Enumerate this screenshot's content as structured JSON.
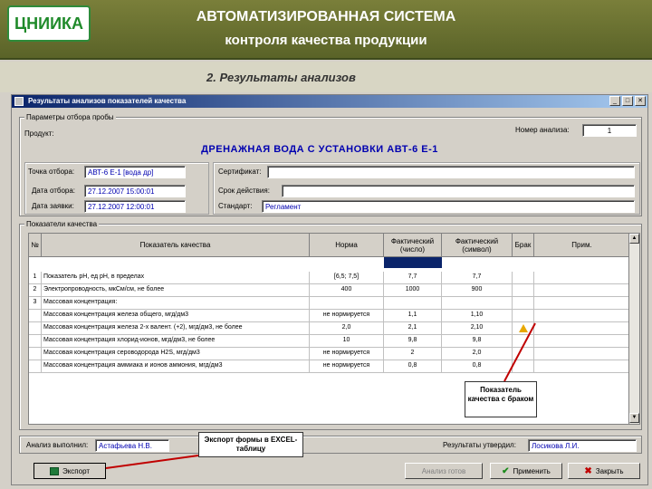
{
  "slide": {
    "logo": "ЦНИИКА",
    "title": "АВТОМАТИЗИРОВАННАЯ СИСТЕМА",
    "subtitle": "контроля качества продукции",
    "section": "2. Результаты анализов"
  },
  "window": {
    "title": "Результаты анализов показателей качества"
  },
  "sample": {
    "group_label": "Параметры отбора пробы",
    "product_label": "Продукт:",
    "product_value": "ДРЕНАЖНАЯ ВОДА С УСТАНОВКИ  АВТ-6  Е-1",
    "analysis_no_label": "Номер анализа:",
    "analysis_no_value": "1",
    "point_label": "Точка отбора:",
    "point_value": "АВТ-6 Е-1 [вода др]",
    "sampled_label": "Дата отбора:",
    "sampled_value": "27.12.2007 15:00:01",
    "received_label": "Дата заявки:",
    "received_value": "27.12.2007 12:00:01",
    "cert_label": "Сертификат:",
    "validity_label": "Срок действия:",
    "standard_label": "Стандарт:",
    "standard_value": "Регламент"
  },
  "quality": {
    "group_label": "Показатели качества",
    "columns": [
      "№",
      "Показатель качества",
      "Норма",
      "Фактический (число)",
      "Фактический (символ)",
      "Брак",
      "Прим."
    ],
    "rows": [
      {
        "n": "1",
        "name": "Показатель рН, ед рН, в пределах",
        "norm": "[6,5; 7,5]",
        "num": "7,7",
        "sym": "7,7"
      },
      {
        "n": "2",
        "name": "Электропроводность, мкСм/см, не более",
        "norm": "400",
        "num": "1000",
        "sym": "900"
      },
      {
        "n": "3",
        "name": "Массовая концентрация:",
        "norm": "",
        "num": "",
        "sym": ""
      },
      {
        "n": "",
        "name": "Массовая концентрация железа общего, мгд/дм3",
        "norm": "не нормируется",
        "num": "1,1",
        "sym": "1,10"
      },
      {
        "n": "",
        "name": "Массовая концентрация железа 2-х валент. (+2), мгд/дм3, не более",
        "norm": "2,0",
        "num": "2,1",
        "sym": "2,10"
      },
      {
        "n": "",
        "name": "Массовая концентрация хлорид-ионов, мгд/дм3, не более",
        "norm": "10",
        "num": "9,8",
        "sym": "9,8"
      },
      {
        "n": "",
        "name": "Массовая концентрация сероводорода H2S, мгд/дм3",
        "norm": "не нормируется",
        "num": "2",
        "sym": "2,0"
      },
      {
        "n": "",
        "name": "Массовая концентрация аммиака и ионов аммония, мгд/дм3",
        "norm": "не нормируется",
        "num": "0,8",
        "sym": "0,8"
      }
    ]
  },
  "footer": {
    "analyst_label": "Анализ выполнил:",
    "analyst_value": "Астафьева Н.В.",
    "approver_label": "Результаты утвердил:",
    "approver_value": "Лосикова Л.И."
  },
  "buttons": {
    "export": "Экспорт",
    "analyze": "Анализ готов",
    "apply": "Применить",
    "close": "Закрыть"
  },
  "callouts": {
    "defect": "Показатель качества с браком",
    "export": "Экспорт формы в EXCEL-таблицу"
  }
}
